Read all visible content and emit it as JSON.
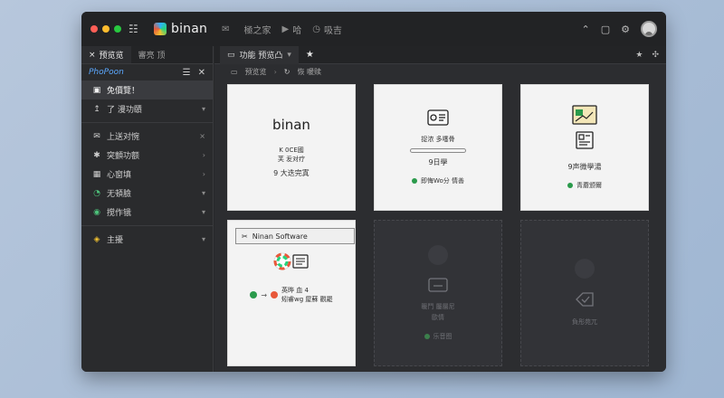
{
  "colors": {
    "red": "#ff5f57",
    "yellow": "#febc2e",
    "green": "#28c840",
    "accent": "#5ba8ff",
    "status_green": "#2a9a4b"
  },
  "title": {
    "logo_text": "binan",
    "nav": [
      {
        "icon": "mail-icon",
        "label": ""
      },
      {
        "icon": "none",
        "label": "極之家"
      },
      {
        "icon": "video-icon",
        "label": "哈"
      },
      {
        "icon": "clock-icon",
        "label": "吸吉"
      }
    ],
    "right_icons": [
      "chevron-up-icon",
      "clipboard-icon",
      "settings-icon"
    ]
  },
  "sidebar": {
    "tabs": [
      {
        "icon": "×",
        "label": "预览览"
      },
      {
        "icon": "",
        "label": "審亮 顶"
      }
    ],
    "brand": "PhoPoon",
    "items": [
      {
        "icon": "▣",
        "label": "免價覽！",
        "tail": "",
        "active": true
      },
      {
        "icon": "↥",
        "label": "了 漫功賾",
        "tail": "▾",
        "active": false
      },
      {
        "icon": "✉",
        "label": "上送对惋",
        "tail": "×",
        "active": false
      },
      {
        "icon": "✱",
        "label": "突顫功额",
        "tail": "›",
        "active": false
      },
      {
        "icon": "▦",
        "label": "心窗填",
        "tail": "›",
        "active": false
      },
      {
        "icon": "◔",
        "label": "无頓臉",
        "tail": "▾",
        "active": false
      },
      {
        "icon": "◉",
        "label": "搅作锇",
        "tail": "▾",
        "active": false
      },
      {
        "icon": "◈",
        "label": "主擾",
        "tail": "▾",
        "active": false
      }
    ]
  },
  "main": {
    "tab_label": "功能 预览凸",
    "tab_close": "▾",
    "breadcrumb": [
      "预览览",
      "›",
      "恢 暖赎"
    ],
    "cards": [
      {
        "brand": "binan",
        "line1": "K 0CE國",
        "line2": "芙 叐对疗",
        "line3": "9 大迭完寘"
      },
      {
        "line1": "捉浓 多噻骨",
        "line2": "9日學",
        "status": "即悔Wo分 情善"
      },
      {
        "line1": "9声微學湯",
        "status": "青蘑颁爾"
      },
      {
        "head": "Ninan Software",
        "line1": "英晔 血 4",
        "line2": "矧睿wg 屋蘇 觀罷"
      },
      {
        "line1": "暖鬥 屬層尼",
        "line2": "歐情",
        "line3": "乐音图"
      },
      {
        "line1": "負彤苑兀"
      }
    ]
  }
}
